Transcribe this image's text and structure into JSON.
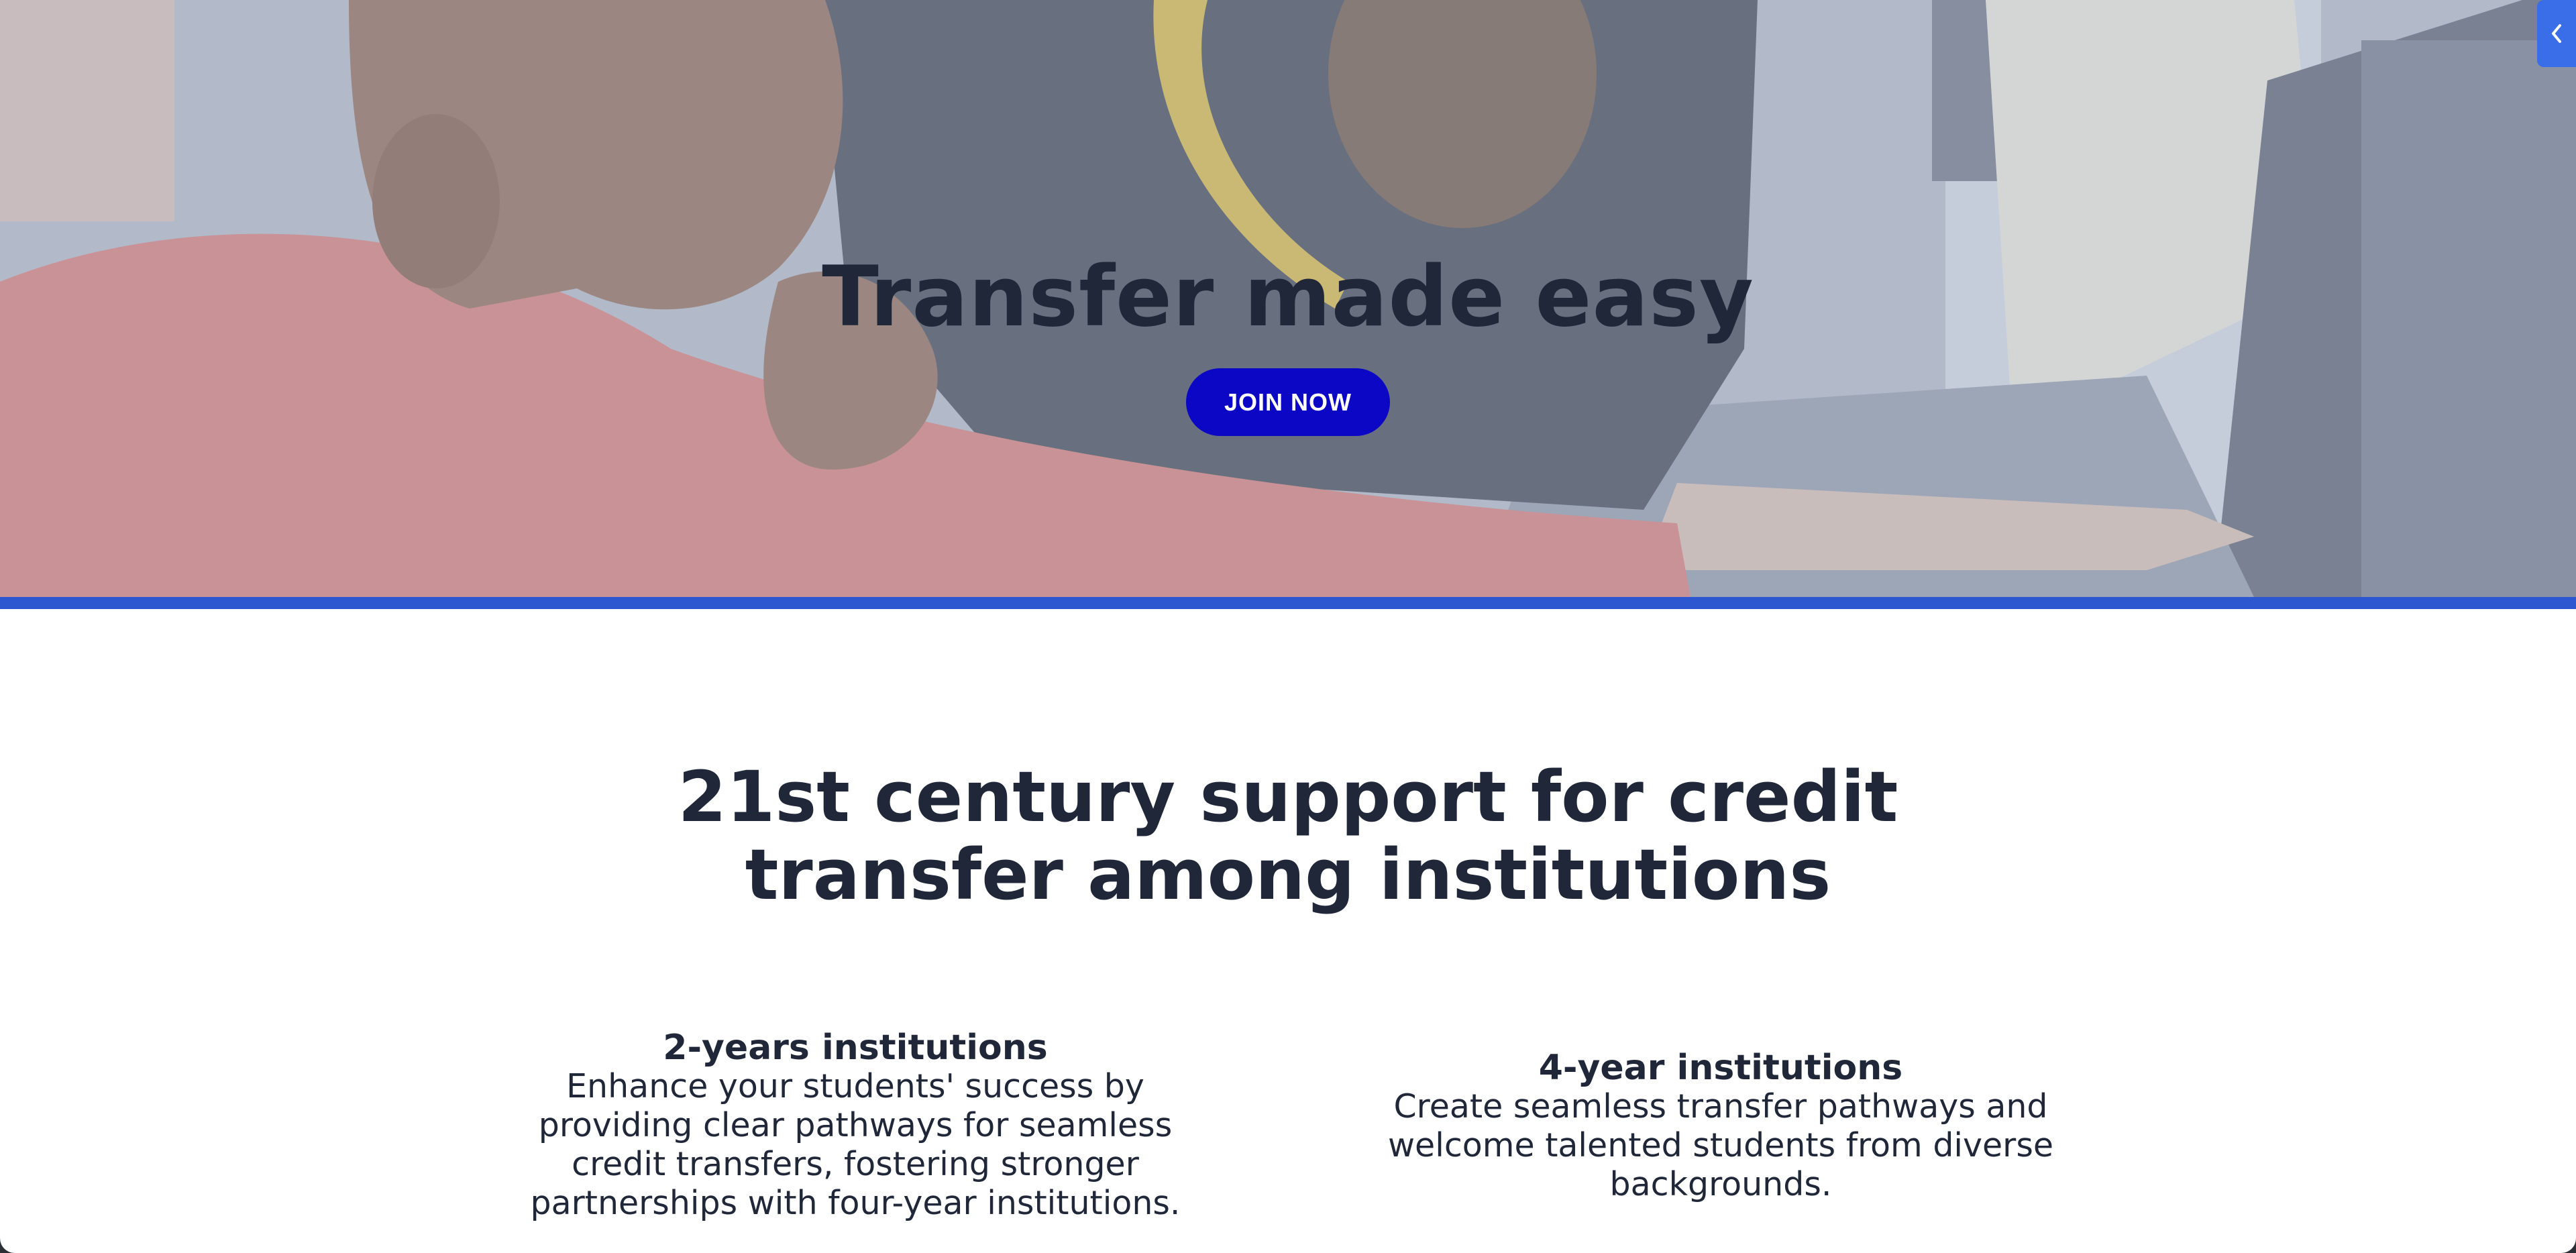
{
  "hero": {
    "title": "Transfer made easy",
    "join_label": "JOIN NOW"
  },
  "intro": {
    "title": "21st century support for credit transfer among institutions"
  },
  "columns": [
    {
      "heading": "2-years institutions",
      "body": "Enhance your students' success by providing clear pathways for seamless credit transfers, fostering stronger partnerships with four-year institutions."
    },
    {
      "heading": "4-year institutions",
      "body": "Create seamless transfer pathways and welcome talented students from diverse backgrounds."
    }
  ],
  "colors": {
    "accent_bar": "#2c57d1",
    "button": "#0b07c4",
    "heading_text": "#1f2738",
    "side_tab": "#3a6ee8"
  },
  "icons": {
    "side_tab": "chevron-left-icon"
  }
}
